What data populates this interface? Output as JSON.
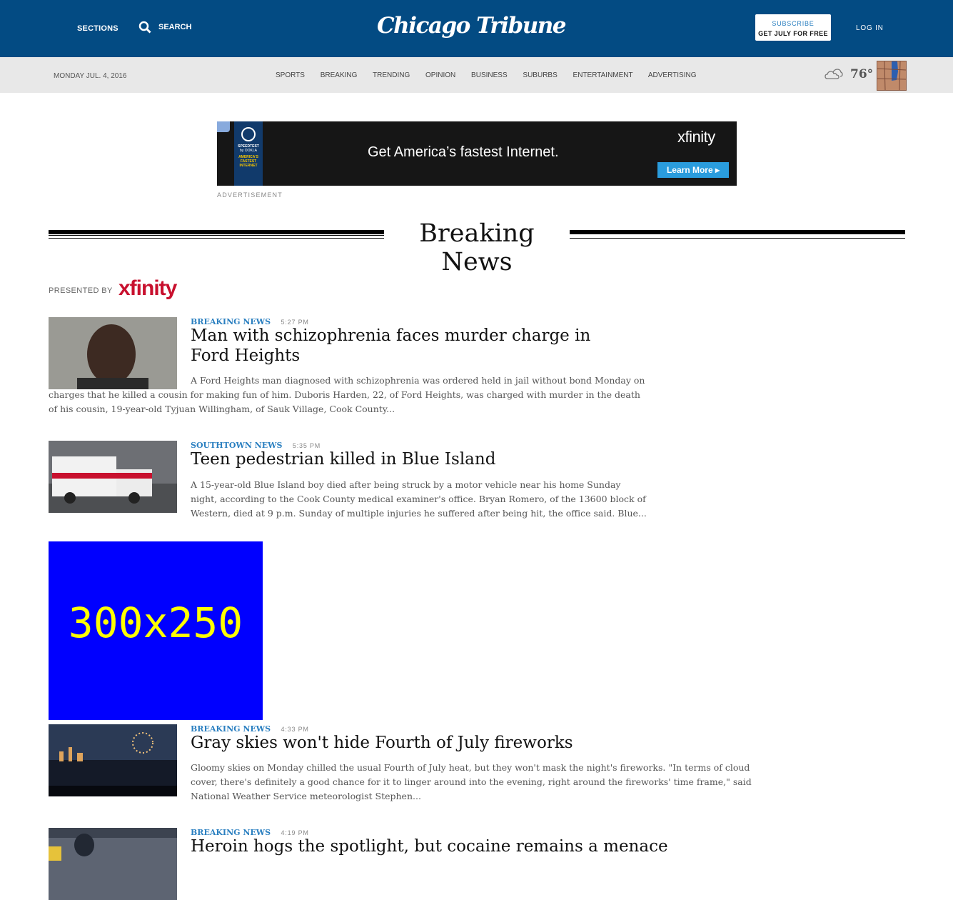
{
  "header": {
    "sections_label": "SECTIONS",
    "search_label": "SEARCH",
    "logo": "Chicago Tribune",
    "subscribe_label": "SUBSCRIBE",
    "subscribe_offer": "GET JULY FOR FREE",
    "login_label": "LOG IN"
  },
  "subnav": {
    "date": "MONDAY JUL. 4, 2016",
    "links": [
      "SPORTS",
      "BREAKING",
      "TRENDING",
      "OPINION",
      "BUSINESS",
      "SUBURBS",
      "ENTERTAINMENT",
      "ADVERTISING"
    ],
    "temperature": "76°"
  },
  "top_ad": {
    "badge_line1": "SPEEDTEST",
    "badge_line2": "by OOKLA",
    "badge_line3": "AMERICA'S FASTEST INTERNET",
    "headline": "Get America’s fastest Internet.",
    "brand": "xfinity",
    "cta": "Learn More ▸",
    "label": "ADVERTISEMENT"
  },
  "section": {
    "title": "Breaking News",
    "presented_by": "PRESENTED BY",
    "sponsor": "xfinity"
  },
  "articles": [
    {
      "category": "BREAKING NEWS",
      "time": "5:27 PM",
      "headline": "Man with schizophrenia faces murder charge in Ford Heights",
      "summary": "A Ford Heights man diagnosed with schizophrenia was ordered held in jail without bond Monday on charges that he killed a cousin for making fun of him. Duboris Harden, 22, of Ford Heights, was charged with murder in the death of his cousin, 19-year-old Tyjuan Willingham, of Sauk Village, Cook County..."
    },
    {
      "category": "SOUTHTOWN NEWS",
      "time": "5:35 PM",
      "headline": "Teen pedestrian killed in Blue Island",
      "summary": "A 15-year-old Blue Island boy died after being struck by a motor vehicle near his home Sunday night, according to the Cook County medical examiner's office. Bryan Romero, of the 13600 block of Western, died at 9 p.m. Sunday of multiple injuries he suffered after being hit, the office said. Blue..."
    },
    {
      "category": "BREAKING NEWS",
      "time": "4:33 PM",
      "headline": "Gray skies won't hide Fourth of July fireworks",
      "summary": "Gloomy skies on Monday chilled the usual Fourth of July heat, but they won't mask the night's fireworks. \"In terms of cloud cover, there's definitely a good chance for it to linger around into the evening, right around the fireworks' time frame,\" said National Weather Service meteorologist Stephen..."
    },
    {
      "category": "BREAKING NEWS",
      "time": "4:19 PM",
      "headline": "Heroin hogs the spotlight, but cocaine remains a menace",
      "summary": ""
    }
  ],
  "inline_ad": {
    "label": "300x250",
    "color": "#0000ff"
  },
  "colors": {
    "header_blue": "#034b83",
    "link_blue": "#2a7fc0",
    "subnav_gray": "#e8e8e8"
  }
}
